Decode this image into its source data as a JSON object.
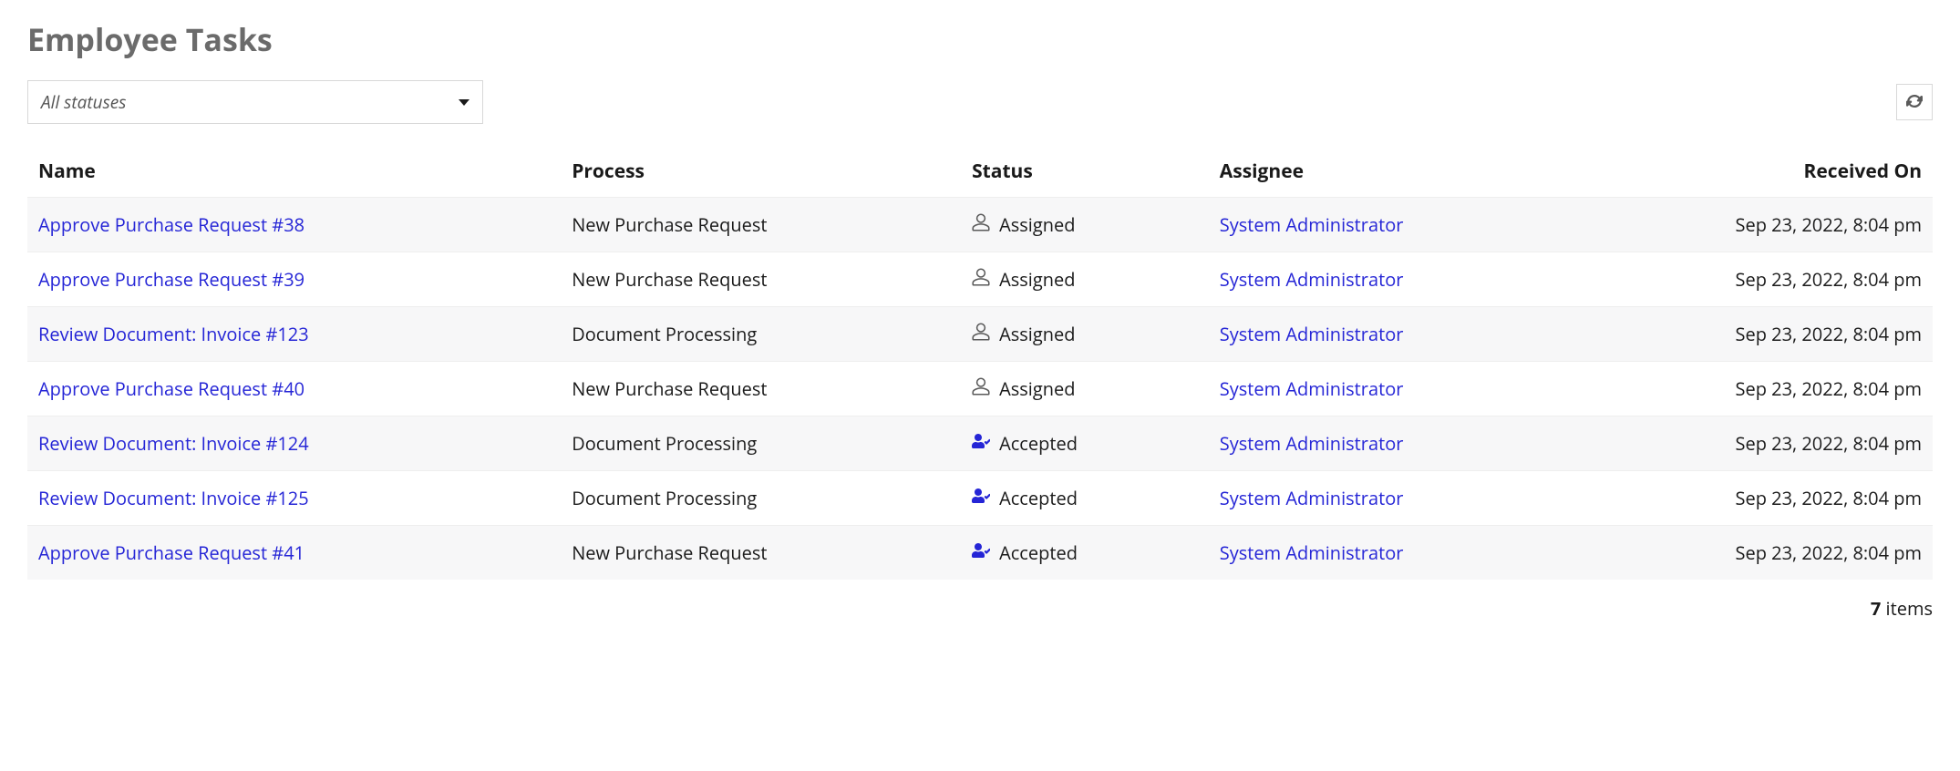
{
  "title": "Employee Tasks",
  "filter": {
    "placeholder": "All statuses"
  },
  "columns": {
    "name": "Name",
    "process": "Process",
    "status": "Status",
    "assignee": "Assignee",
    "received": "Received On"
  },
  "rows": [
    {
      "name": "Approve Purchase Request #38",
      "process": "New Purchase Request",
      "status": "Assigned",
      "status_icon": "user-outline",
      "assignee": "System Administrator",
      "received": "Sep 23, 2022, 8:04 pm"
    },
    {
      "name": "Approve Purchase Request #39",
      "process": "New Purchase Request",
      "status": "Assigned",
      "status_icon": "user-outline",
      "assignee": "System Administrator",
      "received": "Sep 23, 2022, 8:04 pm"
    },
    {
      "name": "Review Document: Invoice #123",
      "process": "Document Processing",
      "status": "Assigned",
      "status_icon": "user-outline",
      "assignee": "System Administrator",
      "received": "Sep 23, 2022, 8:04 pm"
    },
    {
      "name": "Approve Purchase Request #40",
      "process": "New Purchase Request",
      "status": "Assigned",
      "status_icon": "user-outline",
      "assignee": "System Administrator",
      "received": "Sep 23, 2022, 8:04 pm"
    },
    {
      "name": "Review Document: Invoice #124",
      "process": "Document Processing",
      "status": "Accepted",
      "status_icon": "user-check",
      "assignee": "System Administrator",
      "received": "Sep 23, 2022, 8:04 pm"
    },
    {
      "name": "Review Document: Invoice #125",
      "process": "Document Processing",
      "status": "Accepted",
      "status_icon": "user-check",
      "assignee": "System Administrator",
      "received": "Sep 23, 2022, 8:04 pm"
    },
    {
      "name": "Approve Purchase Request #41",
      "process": "New Purchase Request",
      "status": "Accepted",
      "status_icon": "user-check",
      "assignee": "System Administrator",
      "received": "Sep 23, 2022, 8:04 pm"
    }
  ],
  "footer": {
    "count": "7",
    "label": "items"
  }
}
